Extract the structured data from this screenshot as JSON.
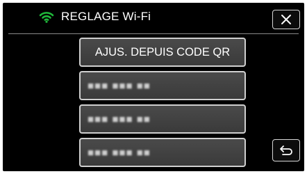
{
  "header": {
    "title": "REGLAGE Wi-Fi",
    "wifi_icon": "wifi-icon",
    "wifi_color": "#1fb83a",
    "close_icon": "close-icon"
  },
  "menu": {
    "items": [
      {
        "label": "AJUS. DEPUIS CODE QR"
      },
      {
        "label": "■■■ ■■■ ■■"
      },
      {
        "label": "■■■ ■■■ ■■"
      },
      {
        "label": "■■■ ■■■ ■■"
      }
    ]
  },
  "footer": {
    "back_icon": "return-arrow-icon"
  }
}
